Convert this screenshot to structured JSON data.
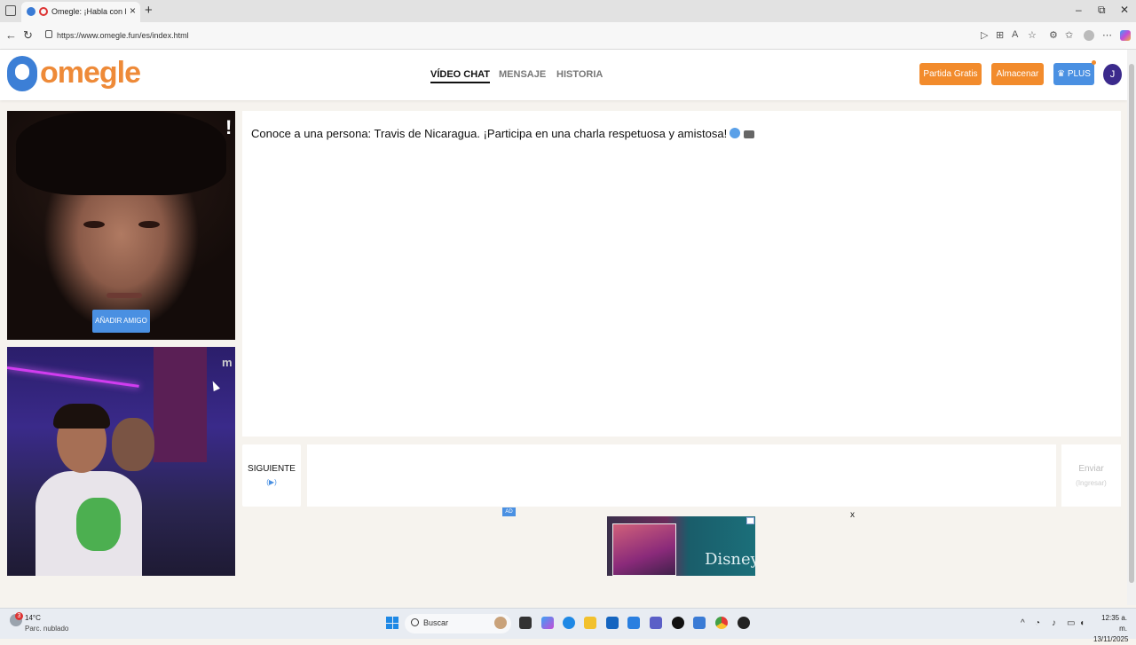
{
  "browser": {
    "tab_title": "Omegle: ¡Habla con Desconocidos!",
    "tab_close": "×",
    "new_tab": "+",
    "url": "https://www.omegle.fun/es/index.html",
    "back": "←",
    "reload": "↻",
    "win_min": "–",
    "win_max": "⧉",
    "win_close": "✕"
  },
  "site": {
    "logo_text": "omegle",
    "nav": [
      "VÍDEO CHAT",
      "MENSAJE",
      "HISTORIA"
    ],
    "buttons": {
      "free_match": "Partida Gratis",
      "store": "Almacenar",
      "plus": "PLUS"
    },
    "avatar_initial": "J",
    "colors": {
      "orange": "#f28b2c",
      "blue": "#4a90e2",
      "accent_text": "#ee8a38"
    }
  },
  "video": {
    "report_label": "!",
    "add_friend": "AÑADIR AMIGO",
    "self_watermark": "m"
  },
  "chat": {
    "message": "Conoce a una persona: Travis de Nicaragua. ¡Participa en una charla respetuosa y amistosa!",
    "next_label": "SIGUIENTE",
    "next_hint": "(▶)",
    "input_placeholder": "",
    "send_label": "Enviar",
    "send_hint": "(Ingresar)"
  },
  "ad": {
    "badge": "AD",
    "close": "x",
    "brand": "Disney"
  },
  "taskbar": {
    "temp": "14°C",
    "condition": "Parc. nublado",
    "weather_badge": "3",
    "search": "Buscar",
    "time": "12:35 a. m.",
    "date": "13/11/2025"
  }
}
